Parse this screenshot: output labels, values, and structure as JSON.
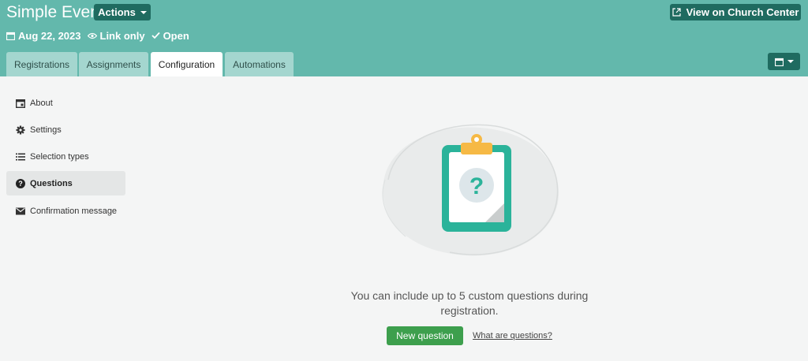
{
  "header": {
    "title": "Simple Event",
    "actions_label": "Actions",
    "view_label": "View on Church Center",
    "date": "Aug 22, 2023",
    "visibility": "Link only",
    "status": "Open"
  },
  "tabs": [
    {
      "label": "Registrations",
      "active": false
    },
    {
      "label": "Assignments",
      "active": false
    },
    {
      "label": "Configuration",
      "active": true
    },
    {
      "label": "Automations",
      "active": false
    }
  ],
  "sidebar": {
    "items": [
      {
        "label": "About",
        "icon": "calendar-icon",
        "active": false
      },
      {
        "label": "Settings",
        "icon": "gear-icon",
        "active": false
      },
      {
        "label": "Selection types",
        "icon": "list-icon",
        "active": false
      },
      {
        "label": "Questions",
        "icon": "question-icon",
        "active": true
      },
      {
        "label": "Confirmation message",
        "icon": "envelope-icon",
        "active": false
      }
    ]
  },
  "main": {
    "illustration_icon": "clipboard-question-icon",
    "empty_message": "You can include up to 5 custom questions during registration.",
    "new_button": "New question",
    "help_link": "What are questions?"
  },
  "colors": {
    "header_bg": "#63b8ac",
    "button_dark": "#1f6b60",
    "tab_inactive": "#a4d6cf",
    "primary_green": "#3d9f4d",
    "clipboard_teal": "#2bb39a",
    "clip_yellow": "#f6b945"
  }
}
